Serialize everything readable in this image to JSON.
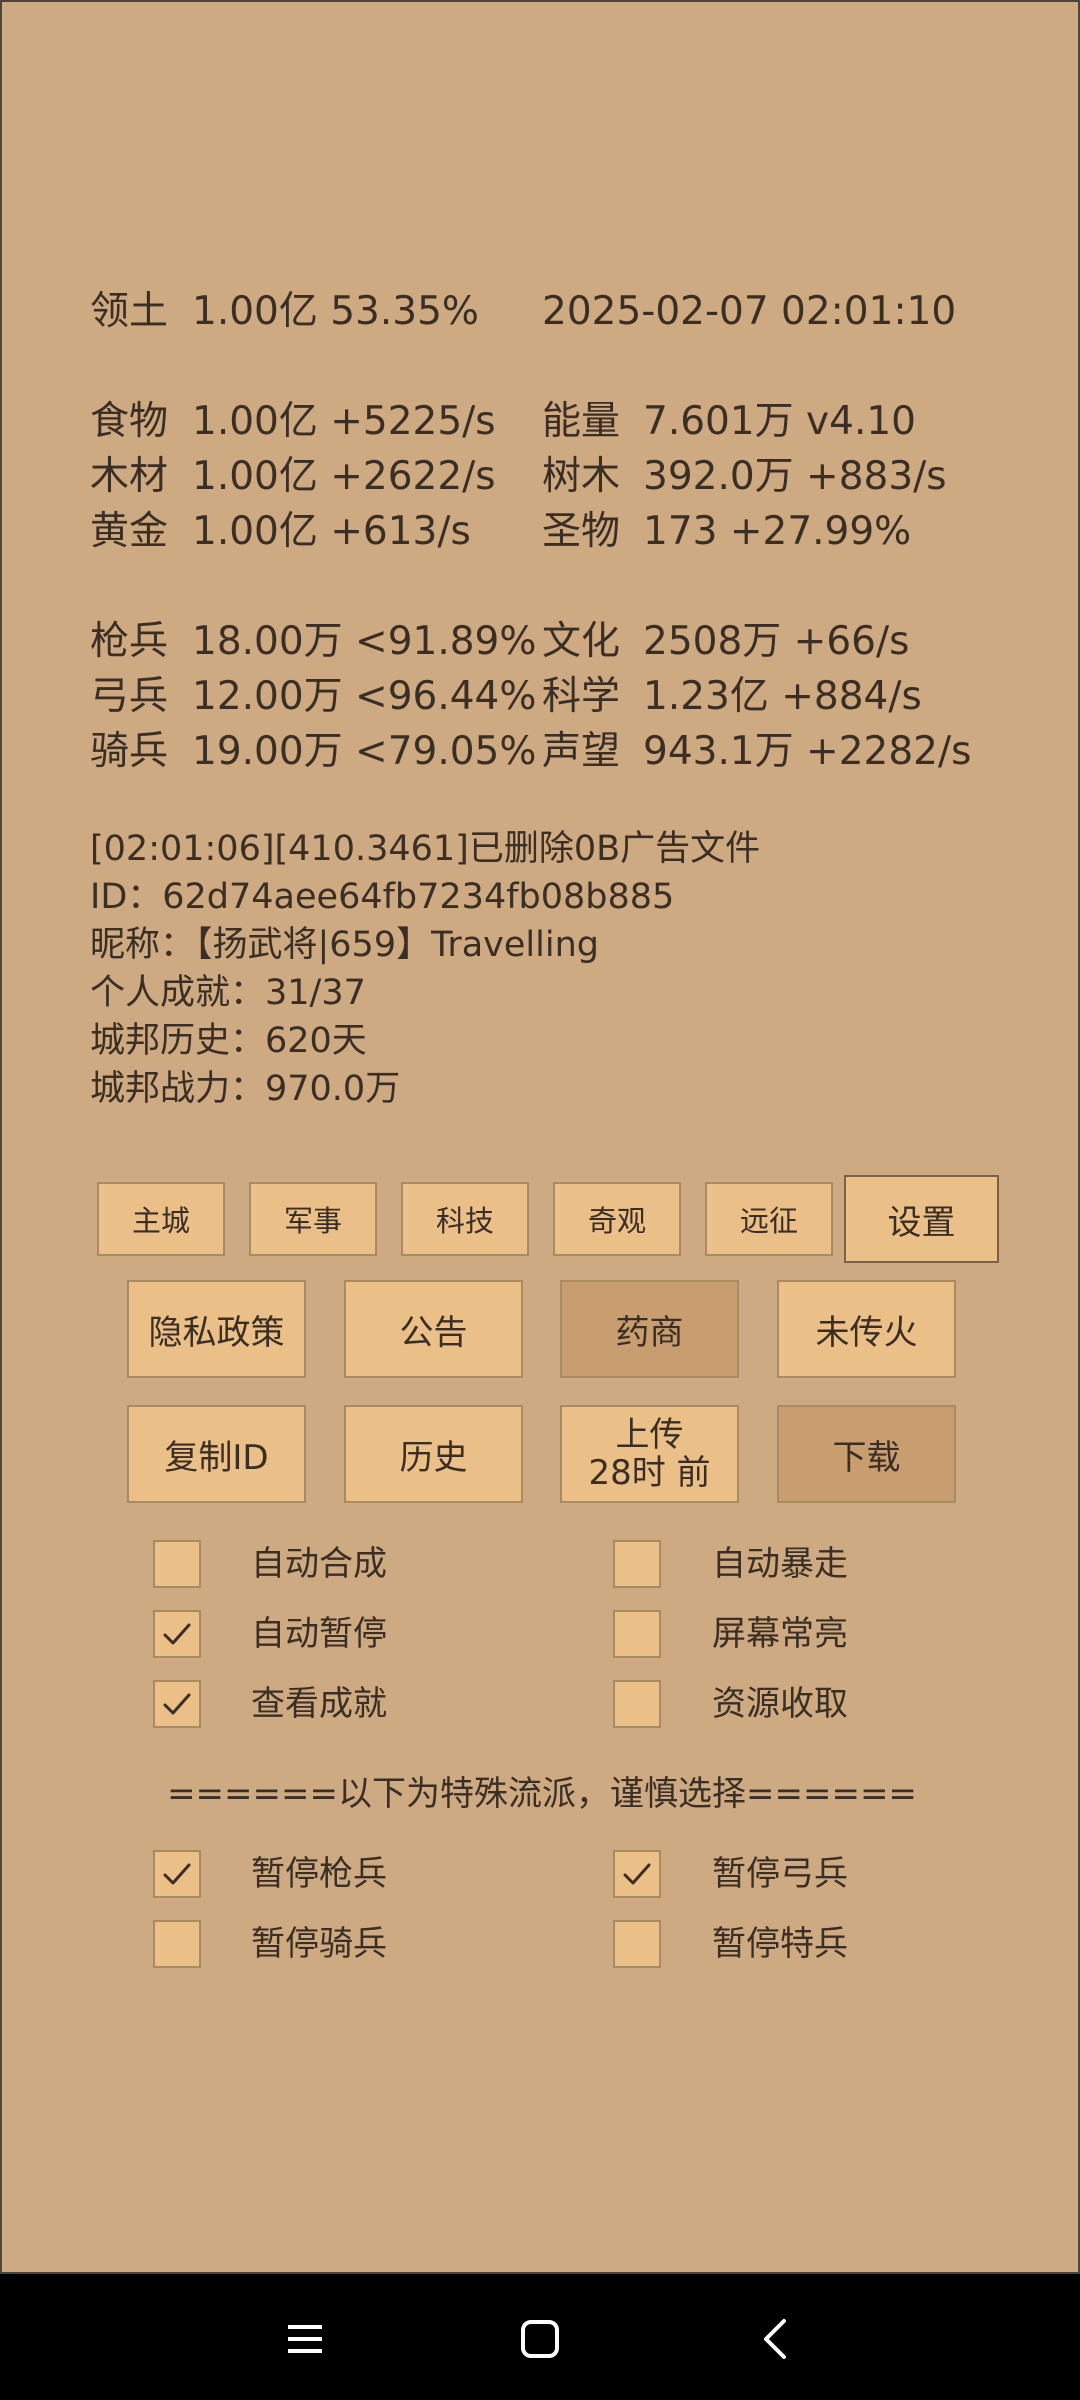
{
  "stats": {
    "territory": {
      "label": "领土",
      "value": "1.00亿  53.35%"
    },
    "datetime": "2025-02-07 02:01:10",
    "left": [
      {
        "label": "食物",
        "value": "1.00亿 +5225/s"
      },
      {
        "label": "木材",
        "value": "1.00亿 +2622/s"
      },
      {
        "label": "黄金",
        "value": "1.00亿 +613/s"
      },
      {
        "label": "枪兵",
        "value": "18.00万 <91.89%"
      },
      {
        "label": "弓兵",
        "value": "12.00万 <96.44%"
      },
      {
        "label": "骑兵",
        "value": "19.00万 <79.05%"
      }
    ],
    "right": [
      {
        "label": "能量",
        "value": "7.601万  v4.10"
      },
      {
        "label": "树木",
        "value": "392.0万 +883/s"
      },
      {
        "label": "圣物",
        "value": "173 +27.99%"
      },
      {
        "label": "文化",
        "value": "2508万 +66/s"
      },
      {
        "label": "科学",
        "value": "1.23亿 +884/s"
      },
      {
        "label": "声望",
        "value": "943.1万 +2282/s"
      }
    ]
  },
  "info": {
    "log": "[02:01:06][410.3461]已删除0B广告文件",
    "id_line": "ID：62d74aee64fb7234fb08b885",
    "nickname_line": "昵称：【扬武将|659】Travelling",
    "achievement_line": "个人成就：31/37",
    "history_line": "城邦历史：620天",
    "power_line": "城邦战力：970.0万"
  },
  "tabs": {
    "main_city": "主城",
    "military": "军事",
    "tech": "科技",
    "wonder": "奇观",
    "expedition": "远征",
    "settings": "设置"
  },
  "buttons": {
    "privacy": "隐私政策",
    "notice": "公告",
    "merchant": "药商",
    "torch": "未传火",
    "copy_id": "复制ID",
    "history": "历史",
    "upload_line1": "上传",
    "upload_line2": "28时 前",
    "download": "下载"
  },
  "options": {
    "auto_synth": {
      "label": "自动合成",
      "checked": false
    },
    "auto_rampage": {
      "label": "自动暴走",
      "checked": false
    },
    "auto_pause": {
      "label": "自动暂停",
      "checked": true
    },
    "screen_on": {
      "label": "屏幕常亮",
      "checked": false
    },
    "view_achievements": {
      "label": "查看成就",
      "checked": true
    },
    "collect_resources": {
      "label": "资源收取",
      "checked": false
    },
    "special_divider": "======以下为特殊流派，谨慎选择======",
    "pause_spear": {
      "label": "暂停枪兵",
      "checked": true
    },
    "pause_archer": {
      "label": "暂停弓兵",
      "checked": true
    },
    "pause_cavalry": {
      "label": "暂停骑兵",
      "checked": false
    },
    "pause_special": {
      "label": "暂停特兵",
      "checked": false
    }
  },
  "navbar": {
    "menu_icon": "menu-icon",
    "home_icon": "home-icon",
    "back_icon": "back-icon"
  },
  "colors": {
    "background": "#cdaa81",
    "button": "#ebbf88",
    "button_active": "#c89e70",
    "text": "#3b2f25"
  }
}
